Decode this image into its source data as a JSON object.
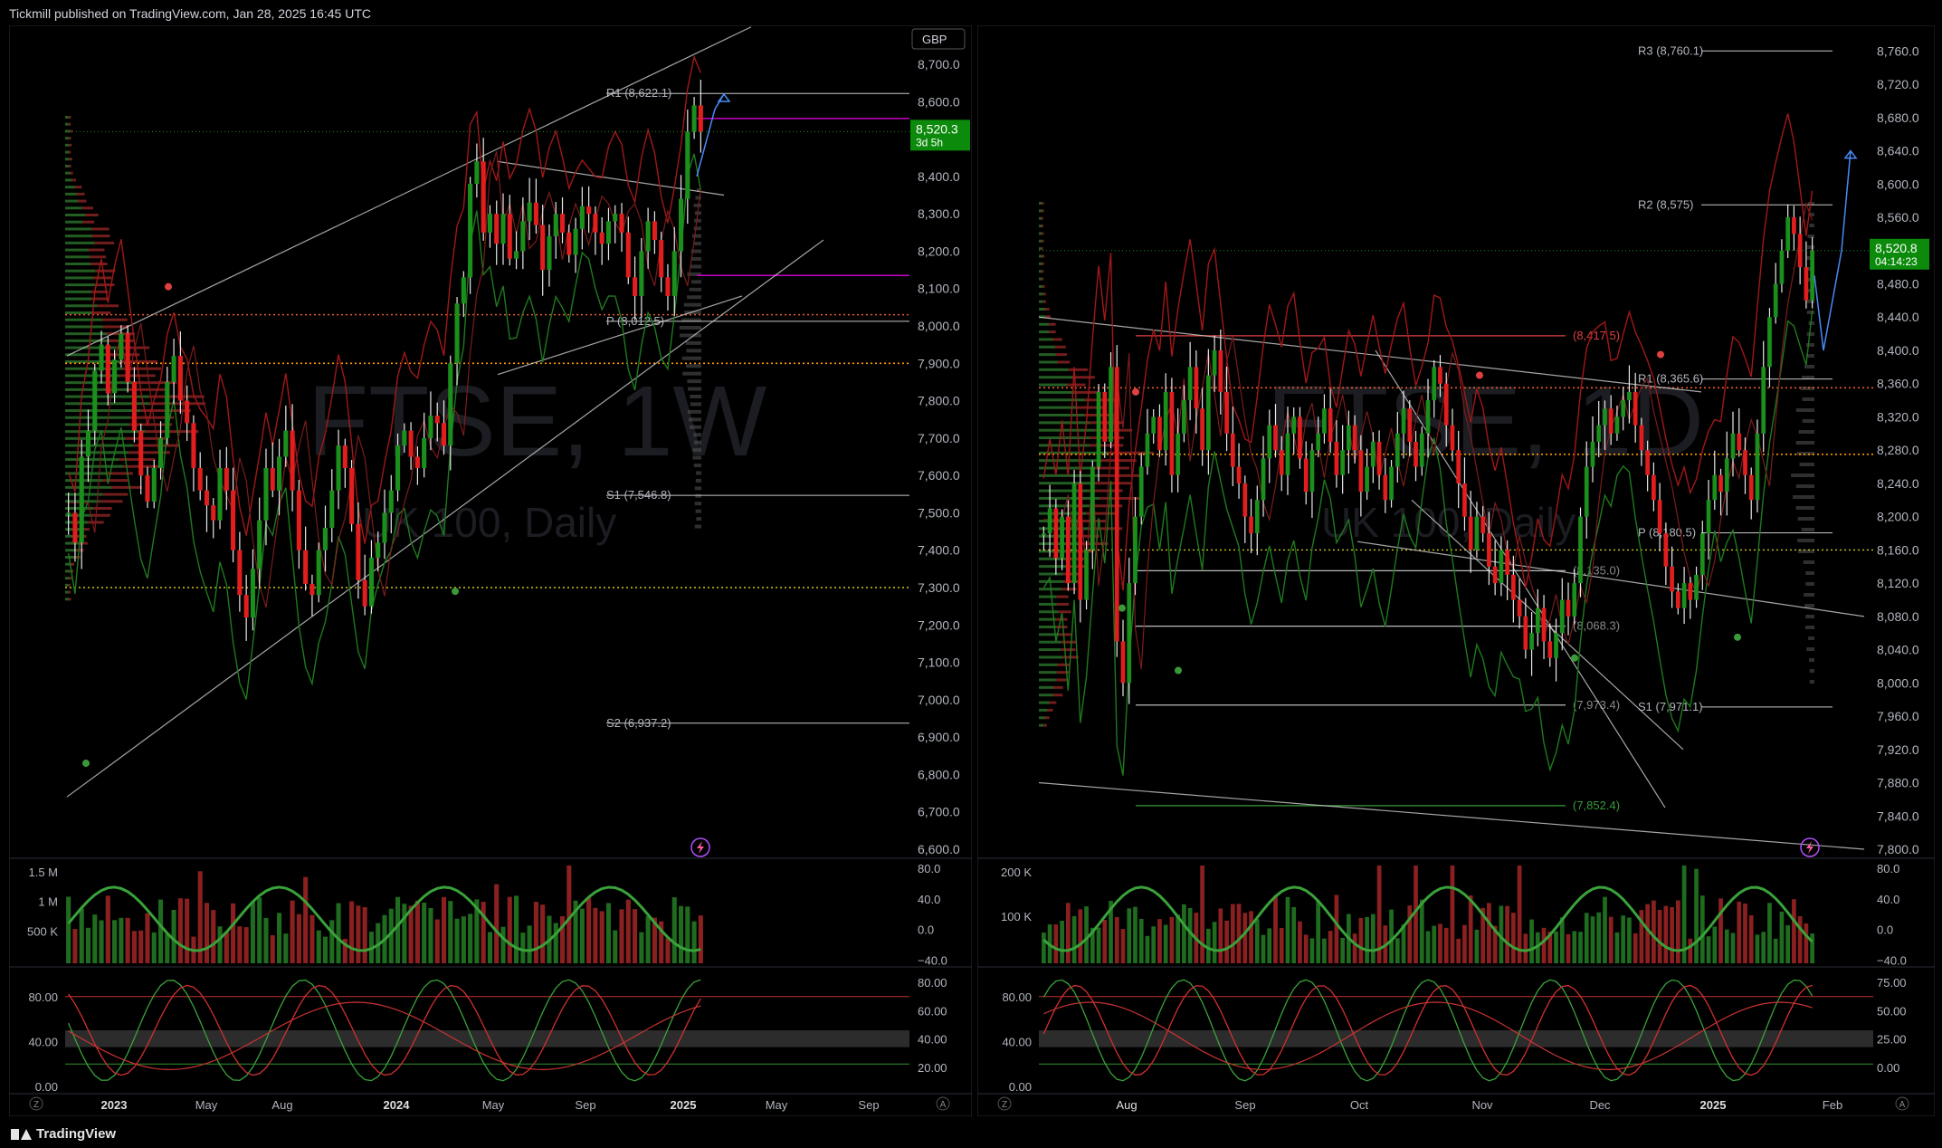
{
  "header": {
    "published": "Tickmill published on TradingView.com, Jan 28, 2025 16:45 UTC"
  },
  "footer": {
    "brand": "TradingView"
  },
  "icons": [
    "tradingview-logo-icon",
    "lightning-icon",
    "z-icon",
    "a-icon"
  ],
  "colors": {
    "up": "#1b8f1b",
    "down": "#e11d1d",
    "price_badge": "#0c8a0c",
    "magenta": "#c800c8",
    "blue": "#4a8af4",
    "orange": "#ff9800"
  },
  "chart_data": [
    {
      "type": "candlestick",
      "currency": "GBP",
      "watermark": "FTSE, 1W",
      "watermark_sub": "UK 100, Daily",
      "y_ticks": [
        "8,700.0",
        "8,600.0",
        "8,500.0",
        "8,400.0",
        "8,300.0",
        "8,200.0",
        "8,100.0",
        "8,000.0",
        "7,900.0",
        "7,800.0",
        "7,700.0",
        "7,600.0",
        "7,500.0",
        "7,400.0",
        "7,300.0",
        "7,200.0",
        "7,100.0",
        "7,000.0",
        "6,900.0",
        "6,800.0",
        "6,700.0",
        "6,600.0"
      ],
      "y_range": [
        6600,
        8780
      ],
      "x_ticks": [
        "2023",
        "May",
        "Aug",
        "2024",
        "May",
        "Sep",
        "2025",
        "May",
        "Sep"
      ],
      "last_price": "8,520.3",
      "last_price_timer": "3d 5h",
      "pivot_labels": [
        "R1 (8,622.1)",
        "P (8,012.5)",
        "S1 (7,546.8)",
        "S2 (6,937.2)"
      ],
      "pivot_values": [
        8622.1,
        8012.5,
        7546.8,
        6937.2
      ],
      "horizontal_levels": {
        "magenta_upper": 8555,
        "magenta_lower": 8135,
        "orange_a": 8030,
        "orange_b": 7900,
        "yellow": 7300
      },
      "volume_ticks": [
        "1.5 M",
        "1 M",
        "500 K"
      ],
      "volume_osc_ticks": [
        "80.0",
        "40.0",
        "0.0",
        "−40.0"
      ],
      "stoch_left_ticks": [
        "80.00",
        "40.00",
        "0.00"
      ],
      "stoch_right_ticks": [
        "80.00",
        "60.00",
        "40.00",
        "20.00"
      ],
      "weekly_closes": [
        7500,
        7420,
        7650,
        7720,
        7880,
        7950,
        7820,
        7910,
        7980,
        7850,
        7720,
        7600,
        7530,
        7620,
        7700,
        7850,
        7920,
        7800,
        7740,
        7620,
        7560,
        7520,
        7480,
        7620,
        7560,
        7400,
        7280,
        7220,
        7350,
        7480,
        7620,
        7560,
        7650,
        7720,
        7560,
        7400,
        7310,
        7280,
        7400,
        7460,
        7560,
        7680,
        7620,
        7470,
        7320,
        7250,
        7380,
        7420,
        7500,
        7560,
        7680,
        7720,
        7650,
        7620,
        7700,
        7760,
        7740,
        7680,
        7900,
        8060,
        8130,
        8380,
        8440,
        8250,
        8300,
        8220,
        8300,
        8180,
        8200,
        8280,
        8330,
        8270,
        8150,
        8240,
        8300,
        8250,
        8190,
        8260,
        8320,
        8300,
        8250,
        8220,
        8280,
        8300,
        8250,
        8130,
        8080,
        8200,
        8280,
        8230,
        8130,
        8080,
        8200,
        8340,
        8520,
        8590,
        8520
      ]
    },
    {
      "type": "candlestick",
      "watermark": "FTSE, 1D",
      "watermark_sub": "UK 100, Daily",
      "y_ticks": [
        "8,760.0",
        "8,720.0",
        "8,680.0",
        "8,640.0",
        "8,600.0",
        "8,560.0",
        "8,520.0",
        "8,480.0",
        "8,440.0",
        "8,400.0",
        "8,360.0",
        "8,320.0",
        "8,280.0",
        "8,240.0",
        "8,200.0",
        "8,160.0",
        "8,120.0",
        "8,080.0",
        "8,040.0",
        "8,000.0",
        "7,960.0",
        "7,920.0",
        "7,880.0",
        "7,840.0",
        "7,800.0"
      ],
      "y_range": [
        7800,
        8780
      ],
      "x_ticks": [
        "Aug",
        "Sep",
        "Oct",
        "Nov",
        "Dec",
        "2025",
        "Feb"
      ],
      "last_price": "8,520.8",
      "last_price_timer": "04:14:23",
      "pivot_labels": [
        "R3 (8,760.1)",
        "R2 (8,575)",
        "R1 (8,365.6)",
        "P (8,180.5)",
        "S1 (7,971.1)"
      ],
      "pivot_values": [
        8760.1,
        8575,
        8365.6,
        8180.5,
        7971.1
      ],
      "fib_labels": [
        "(8,417.5)",
        "(8,135.0)",
        "(8,068.3)",
        "(7,973.4)",
        "(7,852.4)"
      ],
      "fib_values": [
        8417.5,
        8135,
        8068.3,
        7973.4,
        7852.4
      ],
      "horizontal_levels": {
        "orange_a": 8355,
        "orange_b": 8275,
        "yellow": 8160
      },
      "volume_ticks": [
        "200 K",
        "100 K"
      ],
      "volume_osc_ticks": [
        "80.0",
        "40.0",
        "0.0",
        "−40.0"
      ],
      "stoch_left_ticks": [
        "80.00",
        "40.00",
        "0.00"
      ],
      "stoch_right_ticks": [
        "75.00",
        "50.00",
        "25.00",
        "0.00"
      ],
      "daily_closes": [
        8180,
        8210,
        8150,
        8200,
        8120,
        8240,
        8100,
        8160,
        8260,
        8350,
        8290,
        8380,
        8050,
        8000,
        8120,
        8200,
        8260,
        8300,
        8320,
        8280,
        8350,
        8250,
        8300,
        8340,
        8380,
        8330,
        8280,
        8370,
        8400,
        8350,
        8300,
        8260,
        8240,
        8200,
        8180,
        8220,
        8270,
        8310,
        8280,
        8250,
        8300,
        8320,
        8270,
        8230,
        8280,
        8300,
        8330,
        8290,
        8250,
        8280,
        8310,
        8280,
        8230,
        8260,
        8290,
        8250,
        8220,
        8260,
        8300,
        8330,
        8290,
        8260,
        8300,
        8340,
        8380,
        8360,
        8310,
        8280,
        8240,
        8200,
        8160,
        8200,
        8180,
        8140,
        8120,
        8160,
        8130,
        8100,
        8080,
        8040,
        8060,
        8090,
        8050,
        8030,
        8060,
        8100,
        8080,
        8120,
        8200,
        8260,
        8290,
        8310,
        8330,
        8300,
        8320,
        8340,
        8350,
        8310,
        8280,
        8250,
        8220,
        8180,
        8140,
        8110,
        8090,
        8120,
        8100,
        8130,
        8180,
        8220,
        8250,
        8230,
        8270,
        8300,
        8280,
        8250,
        8220,
        8300,
        8380,
        8440,
        8480,
        8520,
        8560,
        8540,
        8500,
        8460,
        8520
      ]
    }
  ]
}
